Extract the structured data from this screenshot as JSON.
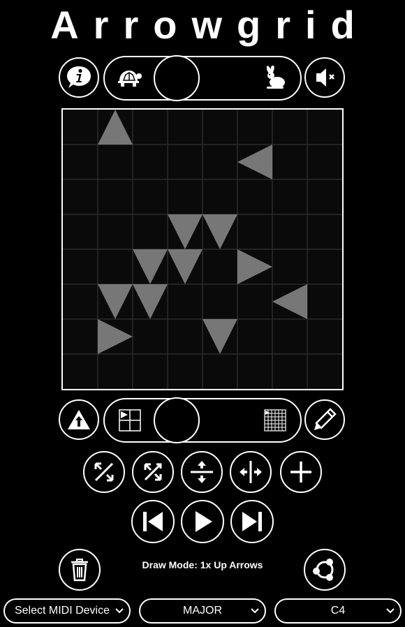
{
  "app": {
    "title": "Arrowgrid"
  },
  "status": {
    "mode_text": "Draw Mode: 1x Up Arrows"
  },
  "selects": {
    "midi": "Select MIDI Device",
    "scale": "MAJOR",
    "root": "C4"
  },
  "sliders": {
    "speed": {
      "min_icon": "turtle-icon",
      "max_icon": "rabbit-icon",
      "value": 0
    },
    "grid_size": {
      "min_icon": "small-grid-icon",
      "max_icon": "large-grid-icon",
      "value": 0
    }
  },
  "grid": {
    "rows": 8,
    "cols": 8,
    "arrow_color": "#777777",
    "arrows": [
      {
        "col": 1,
        "row": 0,
        "dir": "up"
      },
      {
        "col": 5,
        "row": 1,
        "dir": "left"
      },
      {
        "col": 3,
        "row": 3,
        "dir": "down"
      },
      {
        "col": 4,
        "row": 3,
        "dir": "down"
      },
      {
        "col": 2,
        "row": 4,
        "dir": "down"
      },
      {
        "col": 3,
        "row": 4,
        "dir": "down"
      },
      {
        "col": 5,
        "row": 4,
        "dir": "right"
      },
      {
        "col": 1,
        "row": 5,
        "dir": "down"
      },
      {
        "col": 2,
        "row": 5,
        "dir": "down"
      },
      {
        "col": 6,
        "row": 5,
        "dir": "left"
      },
      {
        "col": 1,
        "row": 6,
        "dir": "right"
      },
      {
        "col": 4,
        "row": 6,
        "dir": "down"
      }
    ]
  },
  "icons": {
    "info": "info-icon",
    "mute": "speaker-mute-icon",
    "arrow_type": "up-arrow-triangle-icon",
    "draw": "pencil-icon",
    "rotate": "rotate-icon",
    "flip_diagonal": "flip-diagonal-icon",
    "flip_vertical": "flip-vertical-icon",
    "flip_horizontal": "flip-horizontal-icon",
    "add": "plus-icon",
    "prev": "skip-back-icon",
    "play": "play-icon",
    "next": "skip-forward-icon",
    "delete": "trash-icon",
    "share": "share-icon"
  }
}
